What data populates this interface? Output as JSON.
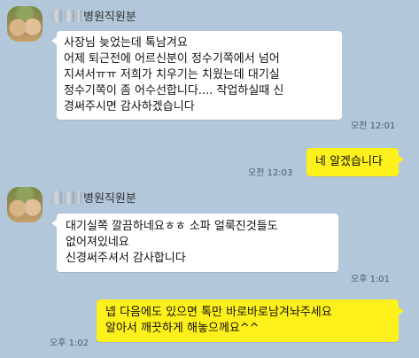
{
  "colors": {
    "background": "#b2c7da",
    "my_bubble": "#fef01b",
    "their_bubble": "#ffffff"
  },
  "messages": [
    {
      "sender": "병원직원분",
      "lines": [
        "사장님 늦었는데 톡남겨요",
        "어제 퇴근전에 어르신분이 정수기쪽에서 넘어",
        "지셔서ㅠㅠ 저희가 치우기는 치웠는데 대기실",
        " 정수기쪽이 좀 어수선합니다.... 작업하실때 신",
        "경써주시면 감사하겠습니다"
      ],
      "time": "오전 12:01"
    },
    {
      "lines": [
        "네 알겠습니다"
      ],
      "time": "오전 12:03"
    },
    {
      "sender": "병원직원분",
      "lines": [
        "대기실쪽 깔끔하네요ㅎㅎ 소파 얼룩진것들도",
        "없어져있네요",
        "신경써주셔서 감사합니다"
      ],
      "time": "오후 1:01"
    },
    {
      "lines": [
        "넵 다음에도 있으면 톡만 바로바로남겨놔주세요",
        "알아서 깨끗하게 해놓으께요^^"
      ],
      "time": "오후 1:02"
    }
  ]
}
